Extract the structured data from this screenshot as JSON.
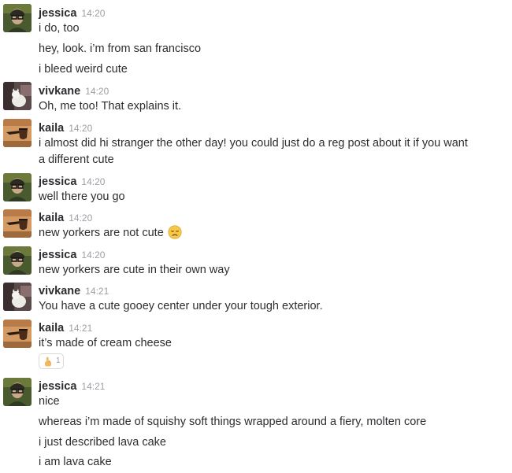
{
  "messages": [
    {
      "author": "jessica",
      "time": "14:20",
      "lines": [
        "i do, too",
        "hey, look. i’m from san francisco",
        "i bleed weird cute"
      ]
    },
    {
      "author": "vivkane",
      "time": "14:20",
      "lines": [
        "Oh, me too! That explains it."
      ]
    },
    {
      "author": "kaila",
      "time": "14:20",
      "lines": [
        "i almost did hi stranger the other day! you could just do a reg post about it if you want",
        "a different cute"
      ]
    },
    {
      "author": "jessica",
      "time": "14:20",
      "lines": [
        "well there you go"
      ]
    },
    {
      "author": "kaila",
      "time": "14:20",
      "lines": [
        "new yorkers are not cute"
      ],
      "emoji": "disappointed-face-icon"
    },
    {
      "author": "jessica",
      "time": "14:20",
      "lines": [
        "new yorkers are cute in their own way"
      ]
    },
    {
      "author": "vivkane",
      "time": "14:21",
      "lines": [
        "You have a cute gooey center under your tough exterior."
      ]
    },
    {
      "author": "kaila",
      "time": "14:21",
      "lines": [
        "it’s made of cream cheese"
      ],
      "reaction": {
        "icon": "pointing-up-hand-icon",
        "count": "1"
      }
    },
    {
      "author": "jessica",
      "time": "14:21",
      "lines": [
        "nice",
        "whereas i’m made of squishy soft things wrapped around a fiery, molten core",
        "i just described lava cake",
        "i am lava cake"
      ]
    }
  ],
  "colors": {
    "username": "#2c2d30",
    "timestamp": "#9e9ea6",
    "message_text": "#2c2d30",
    "reaction_border": "#d9d9db"
  }
}
